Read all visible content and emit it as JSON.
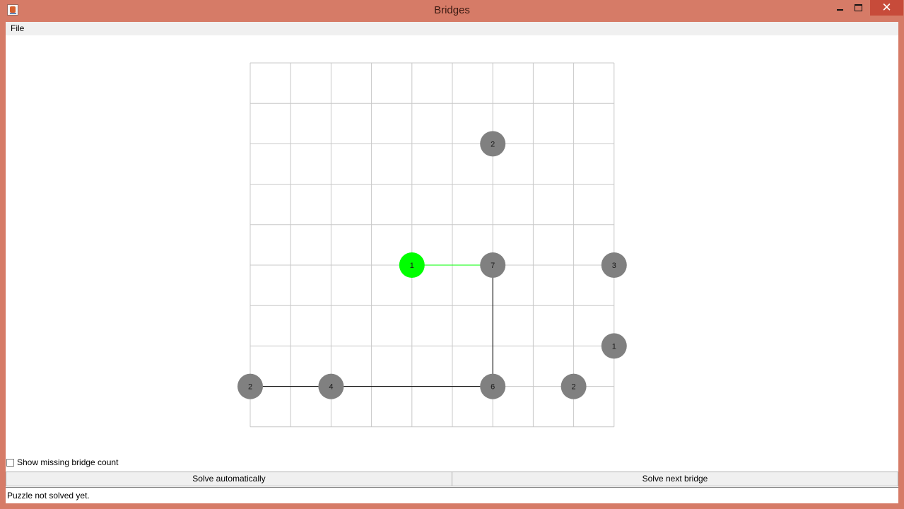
{
  "window": {
    "title": "Bridges"
  },
  "controls": {
    "minimize_icon": "minimize-icon",
    "maximize_icon": "maximize-icon",
    "close_icon": "close-icon",
    "close_glyph": "✕"
  },
  "menu": {
    "file_label": "File"
  },
  "board": {
    "grid_cols": 9,
    "grid_rows": 9,
    "grid_color": "#c8c8c8",
    "island_color": "#808080",
    "selected_color": "#00ff00",
    "bridge_color": "#000000",
    "islands": [
      {
        "col": 6,
        "row": 2,
        "value": "2",
        "selected": false
      },
      {
        "col": 4,
        "row": 5,
        "value": "1",
        "selected": true
      },
      {
        "col": 6,
        "row": 5,
        "value": "7",
        "selected": false
      },
      {
        "col": 9,
        "row": 5,
        "value": "3",
        "selected": false
      },
      {
        "col": 9,
        "row": 7,
        "value": "1",
        "selected": false
      },
      {
        "col": 0,
        "row": 8,
        "value": "2",
        "selected": false
      },
      {
        "col": 2,
        "row": 8,
        "value": "4",
        "selected": false
      },
      {
        "col": 6,
        "row": 8,
        "value": "6",
        "selected": false
      },
      {
        "col": 8,
        "row": 8,
        "value": "2",
        "selected": false
      }
    ],
    "bridges": [
      {
        "from": [
          4,
          5
        ],
        "to": [
          6,
          5
        ],
        "color": "#00ff00"
      },
      {
        "from": [
          6,
          5
        ],
        "to": [
          6,
          8
        ],
        "color": "#000000"
      },
      {
        "from": [
          0,
          8
        ],
        "to": [
          2,
          8
        ],
        "color": "#000000"
      },
      {
        "from": [
          2,
          8
        ],
        "to": [
          6,
          8
        ],
        "color": "#000000"
      }
    ]
  },
  "options": {
    "show_missing_label": "Show missing bridge count",
    "show_missing_checked": false
  },
  "buttons": {
    "solve_auto": "Solve automatically",
    "solve_next": "Solve next bridge"
  },
  "status": {
    "text": "Puzzle not solved yet."
  }
}
